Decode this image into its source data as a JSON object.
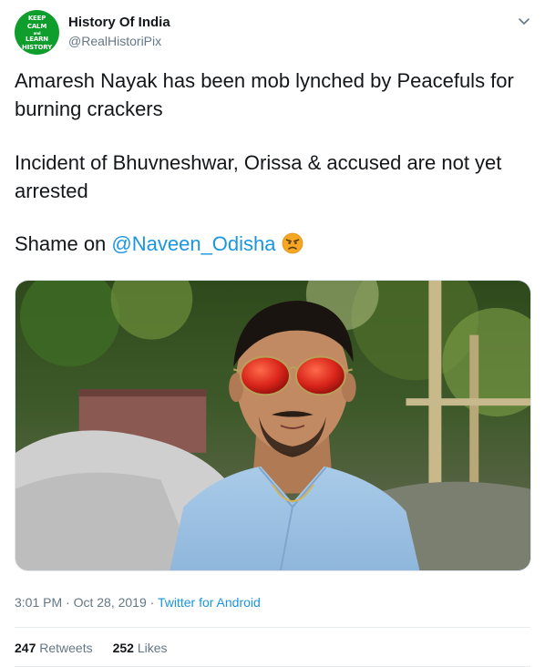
{
  "author": {
    "avatar_text": [
      "KEEP",
      "CALM",
      "and",
      "LEARN",
      "HISTORY"
    ],
    "display_name": "History Of India",
    "handle": "@RealHistoriPix"
  },
  "tweet": {
    "paragraph_1": "Amaresh Nayak has been mob lynched by Peacefuls for burning crackers",
    "paragraph_2": "Incident of Bhuvneshwar, Orissa & accused are not yet arrested",
    "paragraph_3_prefix": "Shame on ",
    "mention": "@Naveen_Odisha",
    "emoji": "angry-face"
  },
  "meta": {
    "time": "3:01 PM",
    "separator": " · ",
    "date": "Oct 28, 2019",
    "source": "Twitter for Android"
  },
  "stats": {
    "retweets_count": "247",
    "retweets_label": "Retweets",
    "likes_count": "252",
    "likes_label": "Likes"
  },
  "colors": {
    "link": "#1b95e0",
    "secondary_text": "#657786",
    "avatar_bg": "#0f9d2c"
  }
}
